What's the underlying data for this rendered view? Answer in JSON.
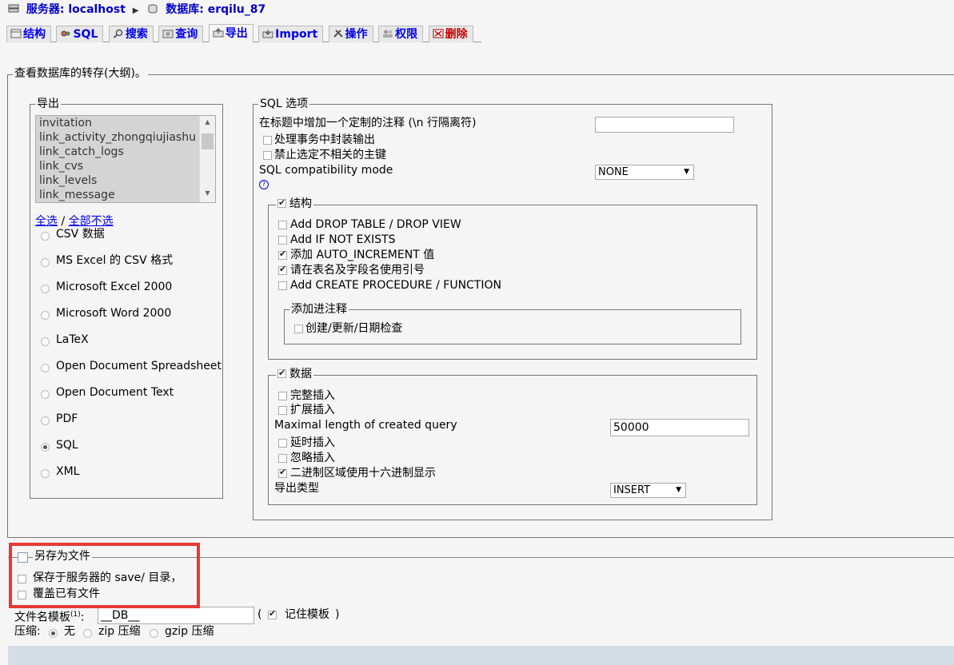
{
  "breadcrumb": {
    "server_label": "服务器: localhost",
    "db_label": "数据库: erqilu_87"
  },
  "tabs": [
    {
      "label": "结构",
      "icon": "structure-icon"
    },
    {
      "label": "SQL",
      "icon": "sql-icon"
    },
    {
      "label": "搜索",
      "icon": "search-icon"
    },
    {
      "label": "查询",
      "icon": "query-icon"
    },
    {
      "label": "导出",
      "icon": "export-icon"
    },
    {
      "label": "Import",
      "icon": "import-icon"
    },
    {
      "label": "操作",
      "icon": "operations-icon"
    },
    {
      "label": "权限",
      "icon": "privileges-icon"
    },
    {
      "label": "删除",
      "icon": "drop-icon"
    }
  ],
  "main_legend": "查看数据库的转存(大纲)。",
  "export": {
    "legend": "导出",
    "tables": [
      "invitation",
      "link_activity_zhongqiujiashu",
      "link_catch_logs",
      "link_cvs",
      "link_levels",
      "link_message"
    ],
    "select_all": "全选",
    "slash": " / ",
    "deselect_all": "全部不选",
    "formats": [
      {
        "label": "CSV 数据",
        "selected": false
      },
      {
        "label": "MS Excel 的 CSV 格式",
        "selected": false
      },
      {
        "label": "Microsoft Excel 2000",
        "selected": false
      },
      {
        "label": "Microsoft Word 2000",
        "selected": false
      },
      {
        "label": "LaTeX",
        "selected": false
      },
      {
        "label": "Open Document Spreadsheet",
        "selected": false
      },
      {
        "label": "Open Document Text",
        "selected": false
      },
      {
        "label": "PDF",
        "selected": false
      },
      {
        "label": "SQL",
        "selected": true
      },
      {
        "label": "XML",
        "selected": false
      }
    ]
  },
  "sql_options": {
    "legend": "SQL 选项",
    "header_comment_label": "在标题中增加一个定制的注释 (\\n 行隔离符)",
    "header_comment_value": "",
    "enclose_transaction": "处理事务中封装输出",
    "disable_fk": "禁止选定不相关的主键",
    "compat_label": "SQL compatibility mode",
    "compat_value": "NONE",
    "help": "?",
    "structure": {
      "legend": "结构",
      "checked": true,
      "options": [
        {
          "label": "Add DROP TABLE / DROP VIEW",
          "checked": false
        },
        {
          "label": "Add IF NOT EXISTS",
          "checked": false
        },
        {
          "label": "添加 AUTO_INCREMENT 值",
          "checked": true
        },
        {
          "label": "请在表名及字段名使用引号",
          "checked": true
        },
        {
          "label": "Add CREATE PROCEDURE / FUNCTION",
          "checked": false
        }
      ],
      "comments_legend": "添加进注释",
      "comments_option": "创建/更新/日期检查"
    },
    "data": {
      "legend": "数据",
      "checked": true,
      "complete_insert": "完整插入",
      "extended_insert": "扩展插入",
      "max_len_label": "Maximal length of created query",
      "max_len_value": "50000",
      "delayed_insert": "延时插入",
      "ignore_insert": "忽略插入",
      "hex_binary": "二进制区域使用十六进制显示",
      "export_type_label": "导出类型",
      "export_type_value": "INSERT"
    }
  },
  "save_file": {
    "label": "另存为文件",
    "save_on_server": "保存于服务器的 save/ 目录，",
    "overwrite": "覆盖已有文件",
    "filename_label": "文件名模板",
    "filename_sup": "(1)",
    "filename_value": "__DB__",
    "remember_open": "(",
    "remember_label": "记住模板",
    "remember_close": ")",
    "compression_label": "压缩:",
    "compression_options": [
      {
        "label": "无",
        "selected": true
      },
      {
        "label": "zip 压缩",
        "selected": false
      },
      {
        "label": "gzip 压缩",
        "selected": false
      }
    ]
  },
  "colors": {
    "highlight": "#e53935",
    "link": "#0000ee",
    "danger": "#cc0000"
  }
}
